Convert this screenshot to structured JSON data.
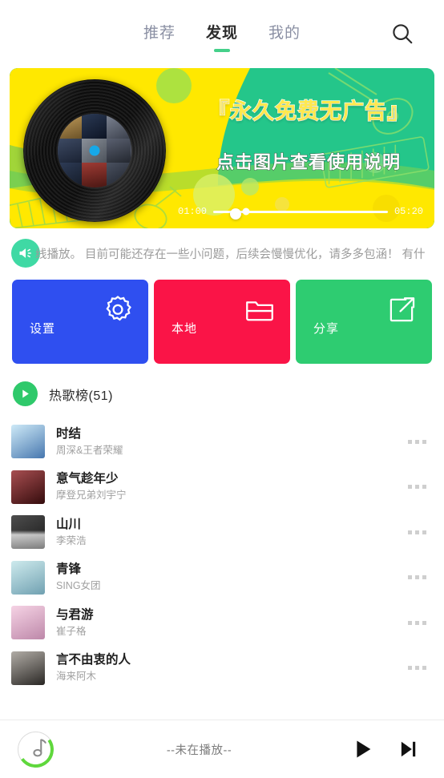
{
  "topbar": {
    "tabs": [
      {
        "label": "推荐",
        "active": false
      },
      {
        "label": "发现",
        "active": true
      },
      {
        "label": "我的",
        "active": false
      }
    ],
    "search_icon": "search-icon"
  },
  "banner": {
    "title": "『永久免费无广告』",
    "subtitle": "点击图片查看使用说明",
    "current_time": "01:00",
    "total_time": "05:20",
    "progress_percent": 19,
    "vinyl_icon": "vinyl-record-icon",
    "bg_colors": {
      "yellow": "#ffe800",
      "green": "#24c68a"
    }
  },
  "notice": {
    "icon": "megaphone-icon",
    "icon_color": "#3fd9a4",
    "text": "线播放。 目前可能还存在一些小问题，后续会慢慢优化，请多多包涵！ 有什"
  },
  "cards": [
    {
      "label": "设置",
      "icon": "gear-icon",
      "color": "#2f4ff0"
    },
    {
      "label": "本地",
      "icon": "folder-icon",
      "color": "#fa1447"
    },
    {
      "label": "分享",
      "icon": "share-icon",
      "color": "#2ecc71"
    }
  ],
  "section": {
    "play_icon": "play-circle-icon",
    "title": "热歌榜(51)",
    "count": 51
  },
  "songs": [
    {
      "title": "时结",
      "artist": "周深&王者荣耀",
      "cover": "cover-blue",
      "more_icon": "more-dots-icon"
    },
    {
      "title": "意气趁年少",
      "artist": "摩登兄弟刘宇宁",
      "cover": "cover-red",
      "more_icon": "more-dots-icon"
    },
    {
      "title": "山川",
      "artist": "李荣浩",
      "cover": "cover-mono",
      "more_icon": "more-dots-icon"
    },
    {
      "title": "青锋",
      "artist": "SING女团",
      "cover": "cover-teal",
      "more_icon": "more-dots-icon"
    },
    {
      "title": "与君游",
      "artist": "崔子格",
      "cover": "cover-pink",
      "more_icon": "more-dots-icon"
    },
    {
      "title": "言不由衷的人",
      "artist": "海来阿木",
      "cover": "cover-sepia",
      "more_icon": "more-dots-icon"
    }
  ],
  "player": {
    "logo_icon": "music-note-logo-icon",
    "status": "--未在播放--",
    "play_icon": "play-icon",
    "next_icon": "next-track-icon"
  }
}
